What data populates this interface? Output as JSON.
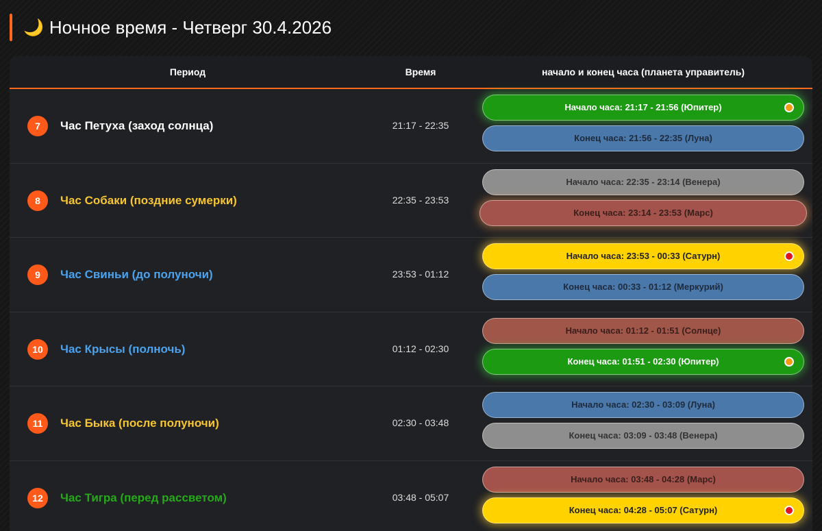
{
  "header": {
    "moon_icon": "🌙",
    "title": "Ночное время - Четверг 30.4.2026",
    "accent_color": "#ff6a1a"
  },
  "columns": {
    "period": "Период",
    "time": "Время",
    "planet": "начало и конец часа (планета управитель)"
  },
  "rows": [
    {
      "num": "7",
      "name": "Час Петуха (заход солнца)",
      "name_color": "#ffffff",
      "time": "21:17 - 22:35",
      "start": {
        "label": "Начало часа: 21:17 - 21:56 (Юпитер)",
        "bg": "#1b9a12",
        "text": "#ffffff",
        "glow": true,
        "dot": "#f39c12"
      },
      "end": {
        "label": "Конец часа: 21:56 - 22:35 (Луна)",
        "bg": "#4a78ab",
        "text": "#1f2a3a",
        "glow": false,
        "dot": ""
      }
    },
    {
      "num": "8",
      "name": "Час Собаки (поздние сумерки)",
      "name_color": "#f6c531",
      "time": "22:35 - 23:53",
      "start": {
        "label": "Начало часа: 22:35 - 23:14 (Венера)",
        "bg": "#8e8e8e",
        "text": "#333333",
        "glow": false,
        "dot": ""
      },
      "end": {
        "label": "Конец часа: 23:14 - 23:53 (Марс)",
        "bg": "#a3534b",
        "text": "#3a1e1b",
        "glow": true,
        "dot": ""
      }
    },
    {
      "num": "9",
      "name": "Час Свиньи (до полуночи)",
      "name_color": "#4aa3f0",
      "time": "23:53 - 01:12",
      "start": {
        "label": "Начало часа: 23:53 - 00:33 (Сатурн)",
        "bg": "#ffd200",
        "text": "#222222",
        "glow": true,
        "dot": "#e0141e"
      },
      "end": {
        "label": "Конец часа: 00:33 - 01:12 (Меркурий)",
        "bg": "#4a78ab",
        "text": "#1f2a3a",
        "glow": false,
        "dot": ""
      }
    },
    {
      "num": "10",
      "name": "Час Крысы (полночь)",
      "name_color": "#4aa3f0",
      "time": "01:12 - 02:30",
      "start": {
        "label": "Начало часа: 01:12 - 01:51 (Солнце)",
        "bg": "#a0574a",
        "text": "#3a1e1b",
        "glow": false,
        "dot": ""
      },
      "end": {
        "label": "Конец часа: 01:51 - 02:30 (Юпитер)",
        "bg": "#1b9a12",
        "text": "#ffffff",
        "glow": true,
        "dot": "#f39c12"
      }
    },
    {
      "num": "11",
      "name": "Час Быка (после полуночи)",
      "name_color": "#f6c531",
      "time": "02:30 - 03:48",
      "start": {
        "label": "Начало часа: 02:30 - 03:09 (Луна)",
        "bg": "#4a78ab",
        "text": "#1f2a3a",
        "glow": false,
        "dot": ""
      },
      "end": {
        "label": "Конец часа: 03:09 - 03:48 (Венера)",
        "bg": "#8e8e8e",
        "text": "#333333",
        "glow": false,
        "dot": ""
      }
    },
    {
      "num": "12",
      "name": "Час Тигра (перед рассветом)",
      "name_color": "#25a819",
      "time": "03:48 - 05:07",
      "start": {
        "label": "Начало часа: 03:48 - 04:28 (Марс)",
        "bg": "#a3534b",
        "text": "#3a1e1b",
        "glow": false,
        "dot": ""
      },
      "end": {
        "label": "Конец часа: 04:28 - 05:07 (Сатурн)",
        "bg": "#ffd200",
        "text": "#222222",
        "glow": true,
        "dot": "#e0141e"
      }
    }
  ]
}
